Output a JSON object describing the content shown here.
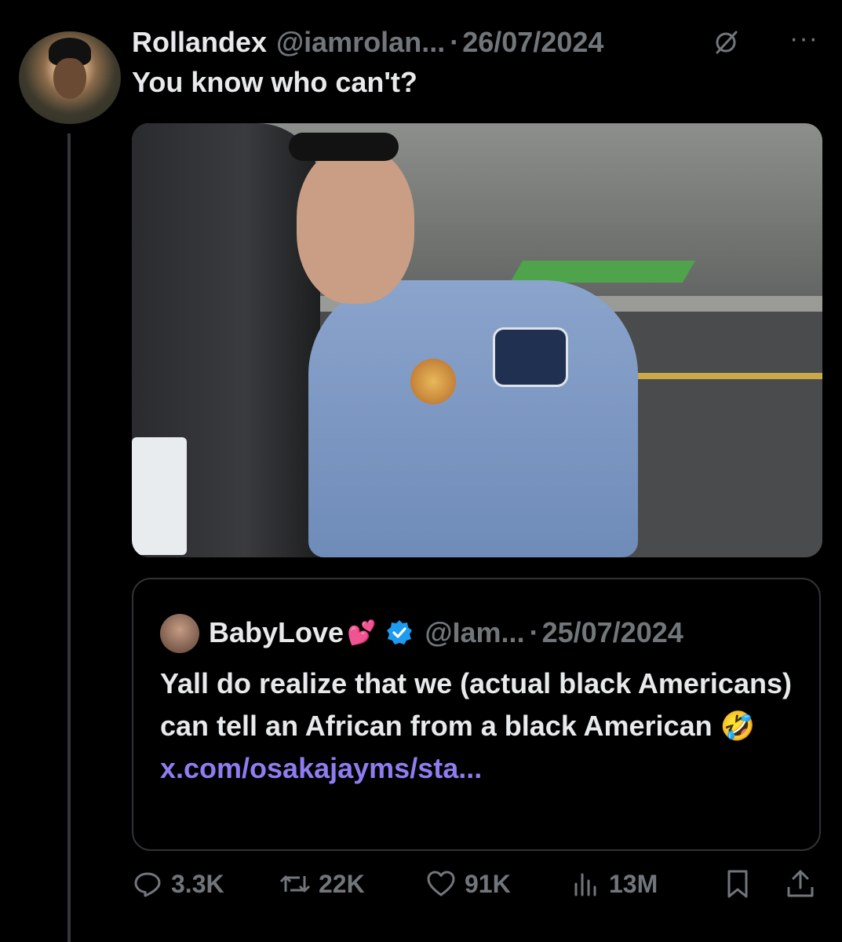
{
  "tweet": {
    "author_name": "Rollandex",
    "author_handle": "@iamrolan...",
    "separator": "·",
    "date": "26/07/2024",
    "text": "You know who can't?",
    "more_label": "···"
  },
  "quoted_tweet": {
    "author_name": "BabyLove",
    "emoji": "💕",
    "author_handle": "@Iam...",
    "separator": "·",
    "date": "25/07/2024",
    "text_main": "Yall do realize that we (actual black Americans) can tell an African from a black American 🤣 ",
    "link": "x.com/osakajayms/sta..."
  },
  "actions": {
    "replies": "3.3K",
    "reposts": "22K",
    "likes": "91K",
    "views": "13M"
  },
  "icons": {
    "accent": "#1d9bf0",
    "link_color": "#8f7cf0"
  }
}
